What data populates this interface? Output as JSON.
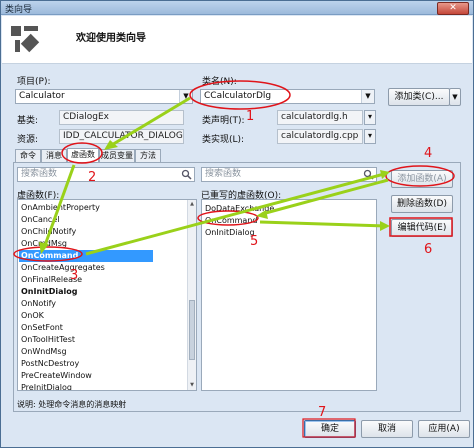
{
  "window": {
    "title": "类向导",
    "close_glyph": "✕"
  },
  "header": {
    "title": "欢迎使用类向导"
  },
  "form": {
    "project_label": "项目(P):",
    "project_value": "Calculator",
    "classname_label": "类名(N):",
    "classname_value": "CCalculatorDlg",
    "add_class_label": "添加类(C)...",
    "base_class_label": "基类:",
    "base_class_value": "CDialogEx",
    "resource_label": "资源:",
    "resource_value": "IDD_CALCULATOR_DIALOG",
    "class_decl_label": "类声明(T):",
    "class_decl_value": "calculatordlg.h",
    "class_impl_label": "类实现(L):",
    "class_impl_value": "calculatordlg.cpp"
  },
  "tabs": [
    {
      "label": "命令"
    },
    {
      "label": "消息"
    },
    {
      "label": "虚函数"
    },
    {
      "label": "成员变量"
    },
    {
      "label": "方法"
    }
  ],
  "left_panel": {
    "search_placeholder": "搜索函数",
    "list_label": "虚函数(F):",
    "items": [
      {
        "text": "OnAmbientProperty"
      },
      {
        "text": "OnCancel"
      },
      {
        "text": "OnChildNotify"
      },
      {
        "text": "OnCmdMsg"
      },
      {
        "text": "OnCommand"
      },
      {
        "text": "OnCreateAggregates"
      },
      {
        "text": "OnFinalRelease"
      },
      {
        "text": "OnInitDialog"
      },
      {
        "text": "OnNotify"
      },
      {
        "text": "OnOK"
      },
      {
        "text": "OnSetFont"
      },
      {
        "text": "OnToolHitTest"
      },
      {
        "text": "OnWndMsg"
      },
      {
        "text": "PostNcDestroy"
      },
      {
        "text": "PreCreateWindow"
      },
      {
        "text": "PreInitDialog"
      }
    ]
  },
  "right_panel": {
    "search_placeholder": "搜索函数",
    "list_label": "已重写的虚函数(O):",
    "items": [
      {
        "text": "DoDataExchange"
      },
      {
        "text": "OnCommand"
      },
      {
        "text": "OnInitDialog"
      }
    ]
  },
  "buttons": {
    "add_function": "添加函数(A)",
    "delete_function": "删除函数(D)",
    "edit_code": "编辑代码(E)"
  },
  "description": "说明:   处理命令消息的消息映射",
  "footer": {
    "ok": "确定",
    "cancel": "取消",
    "apply": "应用(A)"
  },
  "annotations": [
    "1",
    "2",
    "3",
    "4",
    "5",
    "6",
    "7"
  ],
  "colors": {
    "annotation": "#e0141a",
    "arrow": "#9ad11a",
    "selection": "#3399ff"
  },
  "icons": {
    "wizard": "wand-icon",
    "search": "search-icon"
  }
}
